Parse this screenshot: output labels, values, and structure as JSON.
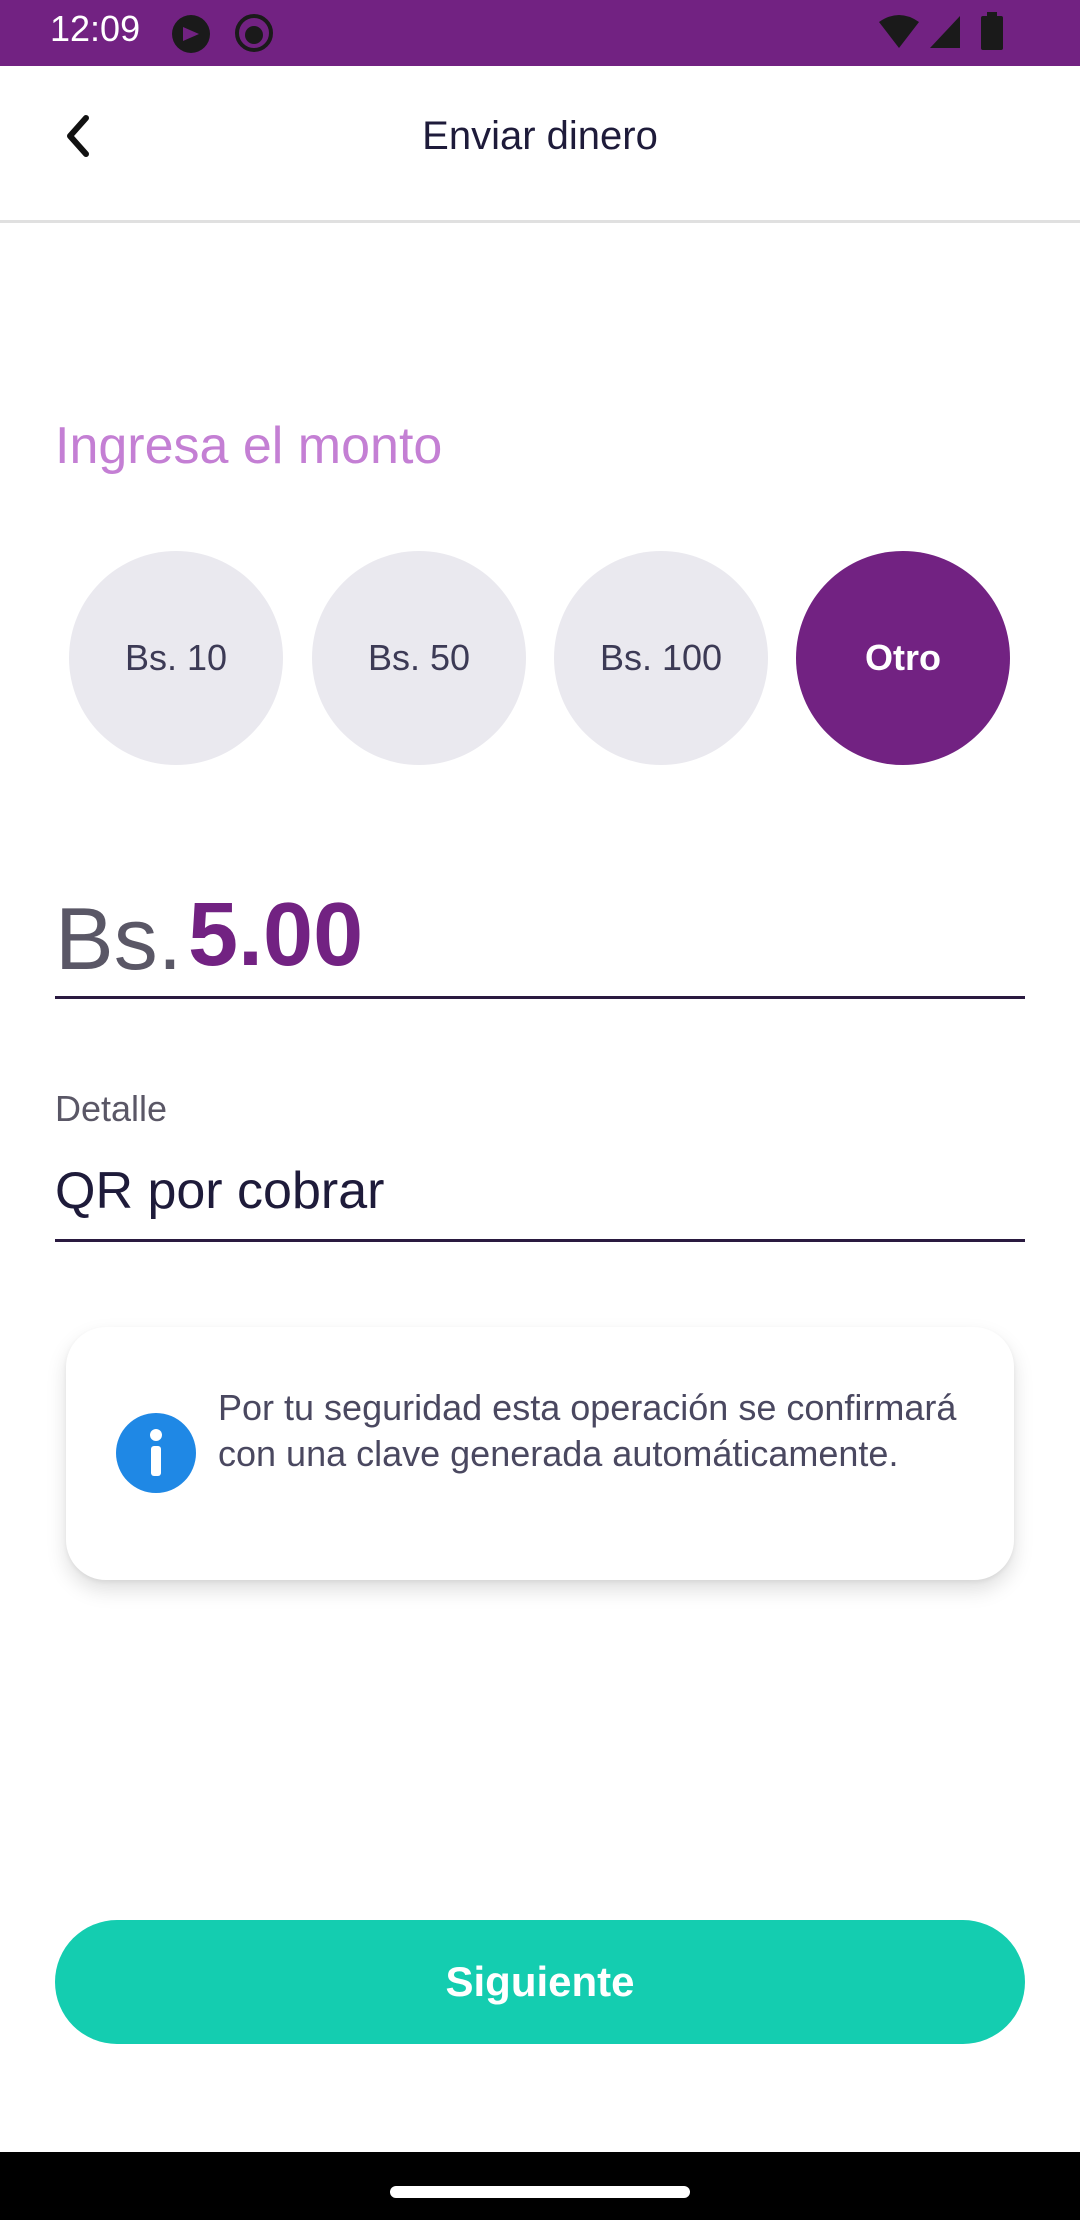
{
  "status_bar": {
    "time": "12:09",
    "background_color": "#722282",
    "icons": [
      "app-notification-icon",
      "github-icon",
      "wifi-icon",
      "signal-icon",
      "battery-icon"
    ]
  },
  "app_bar": {
    "title": "Enviar dinero",
    "back_icon": "chevron-left-icon"
  },
  "amount_section": {
    "heading": "Ingresa el monto",
    "options": [
      {
        "label": "Bs. 10",
        "selected": false
      },
      {
        "label": "Bs. 50",
        "selected": false
      },
      {
        "label": "Bs. 100",
        "selected": false
      },
      {
        "label": "Otro",
        "selected": true
      }
    ],
    "currency": "Bs.",
    "value": "5.00"
  },
  "detail": {
    "label": "Detalle",
    "value": "QR por cobrar"
  },
  "info_card": {
    "icon": "info-icon",
    "text": "Por tu seguridad esta operación se confirmará con una clave generada automáticamente."
  },
  "next_button": {
    "label": "Siguiente"
  },
  "colors": {
    "primary": "#722282",
    "accent": "#14cdb0",
    "heading": "#c47fd4",
    "chip_bg": "#eae9ef",
    "info_blue": "#1f88e5"
  }
}
